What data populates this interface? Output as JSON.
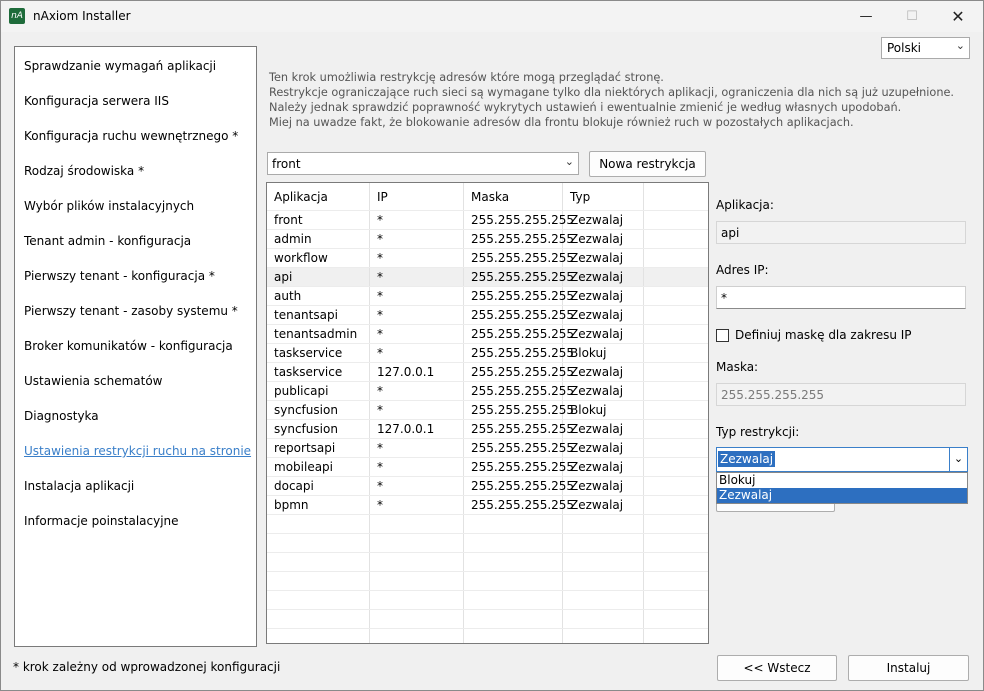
{
  "window": {
    "icon_text": "nA",
    "title": "nAxiom Installer",
    "controls": {
      "minimize": "—",
      "maximize": "☐",
      "close": "✕"
    }
  },
  "language": {
    "selected": "Polski"
  },
  "steps": [
    {
      "label": "Sprawdzanie wymagań aplikacji"
    },
    {
      "label": "Konfiguracja serwera IIS"
    },
    {
      "label": "Konfiguracja ruchu wewnętrznego *"
    },
    {
      "label": "Rodzaj środowiska *"
    },
    {
      "label": "Wybór plików instalacyjnych"
    },
    {
      "label": "Tenant admin - konfiguracja"
    },
    {
      "label": "Pierwszy tenant - konfiguracja *"
    },
    {
      "label": "Pierwszy tenant - zasoby systemu *"
    },
    {
      "label": "Broker komunikatów - konfiguracja"
    },
    {
      "label": "Ustawienia schematów"
    },
    {
      "label": "Diagnostyka"
    },
    {
      "label": "Ustawienia restrykcji ruchu na stronie"
    },
    {
      "label": "Instalacja aplikacji"
    },
    {
      "label": "Informacje poinstalacyjne"
    }
  ],
  "footnote": "* krok zależny od wprowadzonej konfiguracji",
  "info_lines": [
    "Ten krok umożliwia restrykcję adresów które mogą przeglądać stronę.",
    "Restrykcje ograniczające ruch sieci są wymagane tylko dla niektórych aplikacji, ograniczenia dla nich są już uzupełnione.",
    "Należy jednak sprawdzić poprawność wykrytych ustawień i ewentualnie zmienić je według własnych upodobań.",
    "Miej na uwadze fakt, że blokowanie adresów dla frontu blokuje również ruch w pozostałych aplikacjach."
  ],
  "app_combo": {
    "value": "front"
  },
  "new_restriction_label": "Nowa restrykcja",
  "table": {
    "headers": [
      "Aplikacja",
      "IP",
      "Maska",
      "Typ",
      ""
    ],
    "rows": [
      [
        "front",
        "*",
        "255.255.255.255",
        "Zezwalaj"
      ],
      [
        "admin",
        "*",
        "255.255.255.255",
        "Zezwalaj"
      ],
      [
        "workflow",
        "*",
        "255.255.255.255",
        "Zezwalaj"
      ],
      [
        "api",
        "*",
        "255.255.255.255",
        "Zezwalaj"
      ],
      [
        "auth",
        "*",
        "255.255.255.255",
        "Zezwalaj"
      ],
      [
        "tenantsapi",
        "*",
        "255.255.255.255",
        "Zezwalaj"
      ],
      [
        "tenantsadmin",
        "*",
        "255.255.255.255",
        "Zezwalaj"
      ],
      [
        "taskservice",
        "*",
        "255.255.255.255",
        "Blokuj"
      ],
      [
        "taskservice",
        "127.0.0.1",
        "255.255.255.255",
        "Zezwalaj"
      ],
      [
        "publicapi",
        "*",
        "255.255.255.255",
        "Zezwalaj"
      ],
      [
        "syncfusion",
        "*",
        "255.255.255.255",
        "Blokuj"
      ],
      [
        "syncfusion",
        "127.0.0.1",
        "255.255.255.255",
        "Zezwalaj"
      ],
      [
        "reportsapi",
        "*",
        "255.255.255.255",
        "Zezwalaj"
      ],
      [
        "mobileapi",
        "*",
        "255.255.255.255",
        "Zezwalaj"
      ],
      [
        "docapi",
        "*",
        "255.255.255.255",
        "Zezwalaj"
      ],
      [
        "bpmn",
        "*",
        "255.255.255.255",
        "Zezwalaj"
      ]
    ]
  },
  "detail": {
    "app_label": "Aplikacja:",
    "app_value": "api",
    "ip_label": "Adres IP:",
    "ip_value": "*",
    "mask_check_label": "Definiuj maskę dla zakresu IP",
    "mask_label": "Maska:",
    "mask_value": "255.255.255.255",
    "type_label": "Typ restrykcji:",
    "type_value": "Zezwalaj",
    "type_options": [
      "Blokuj",
      "Zezwalaj"
    ]
  },
  "footer": {
    "back_label": "<< Wstecz",
    "install_label": "Instaluj"
  }
}
